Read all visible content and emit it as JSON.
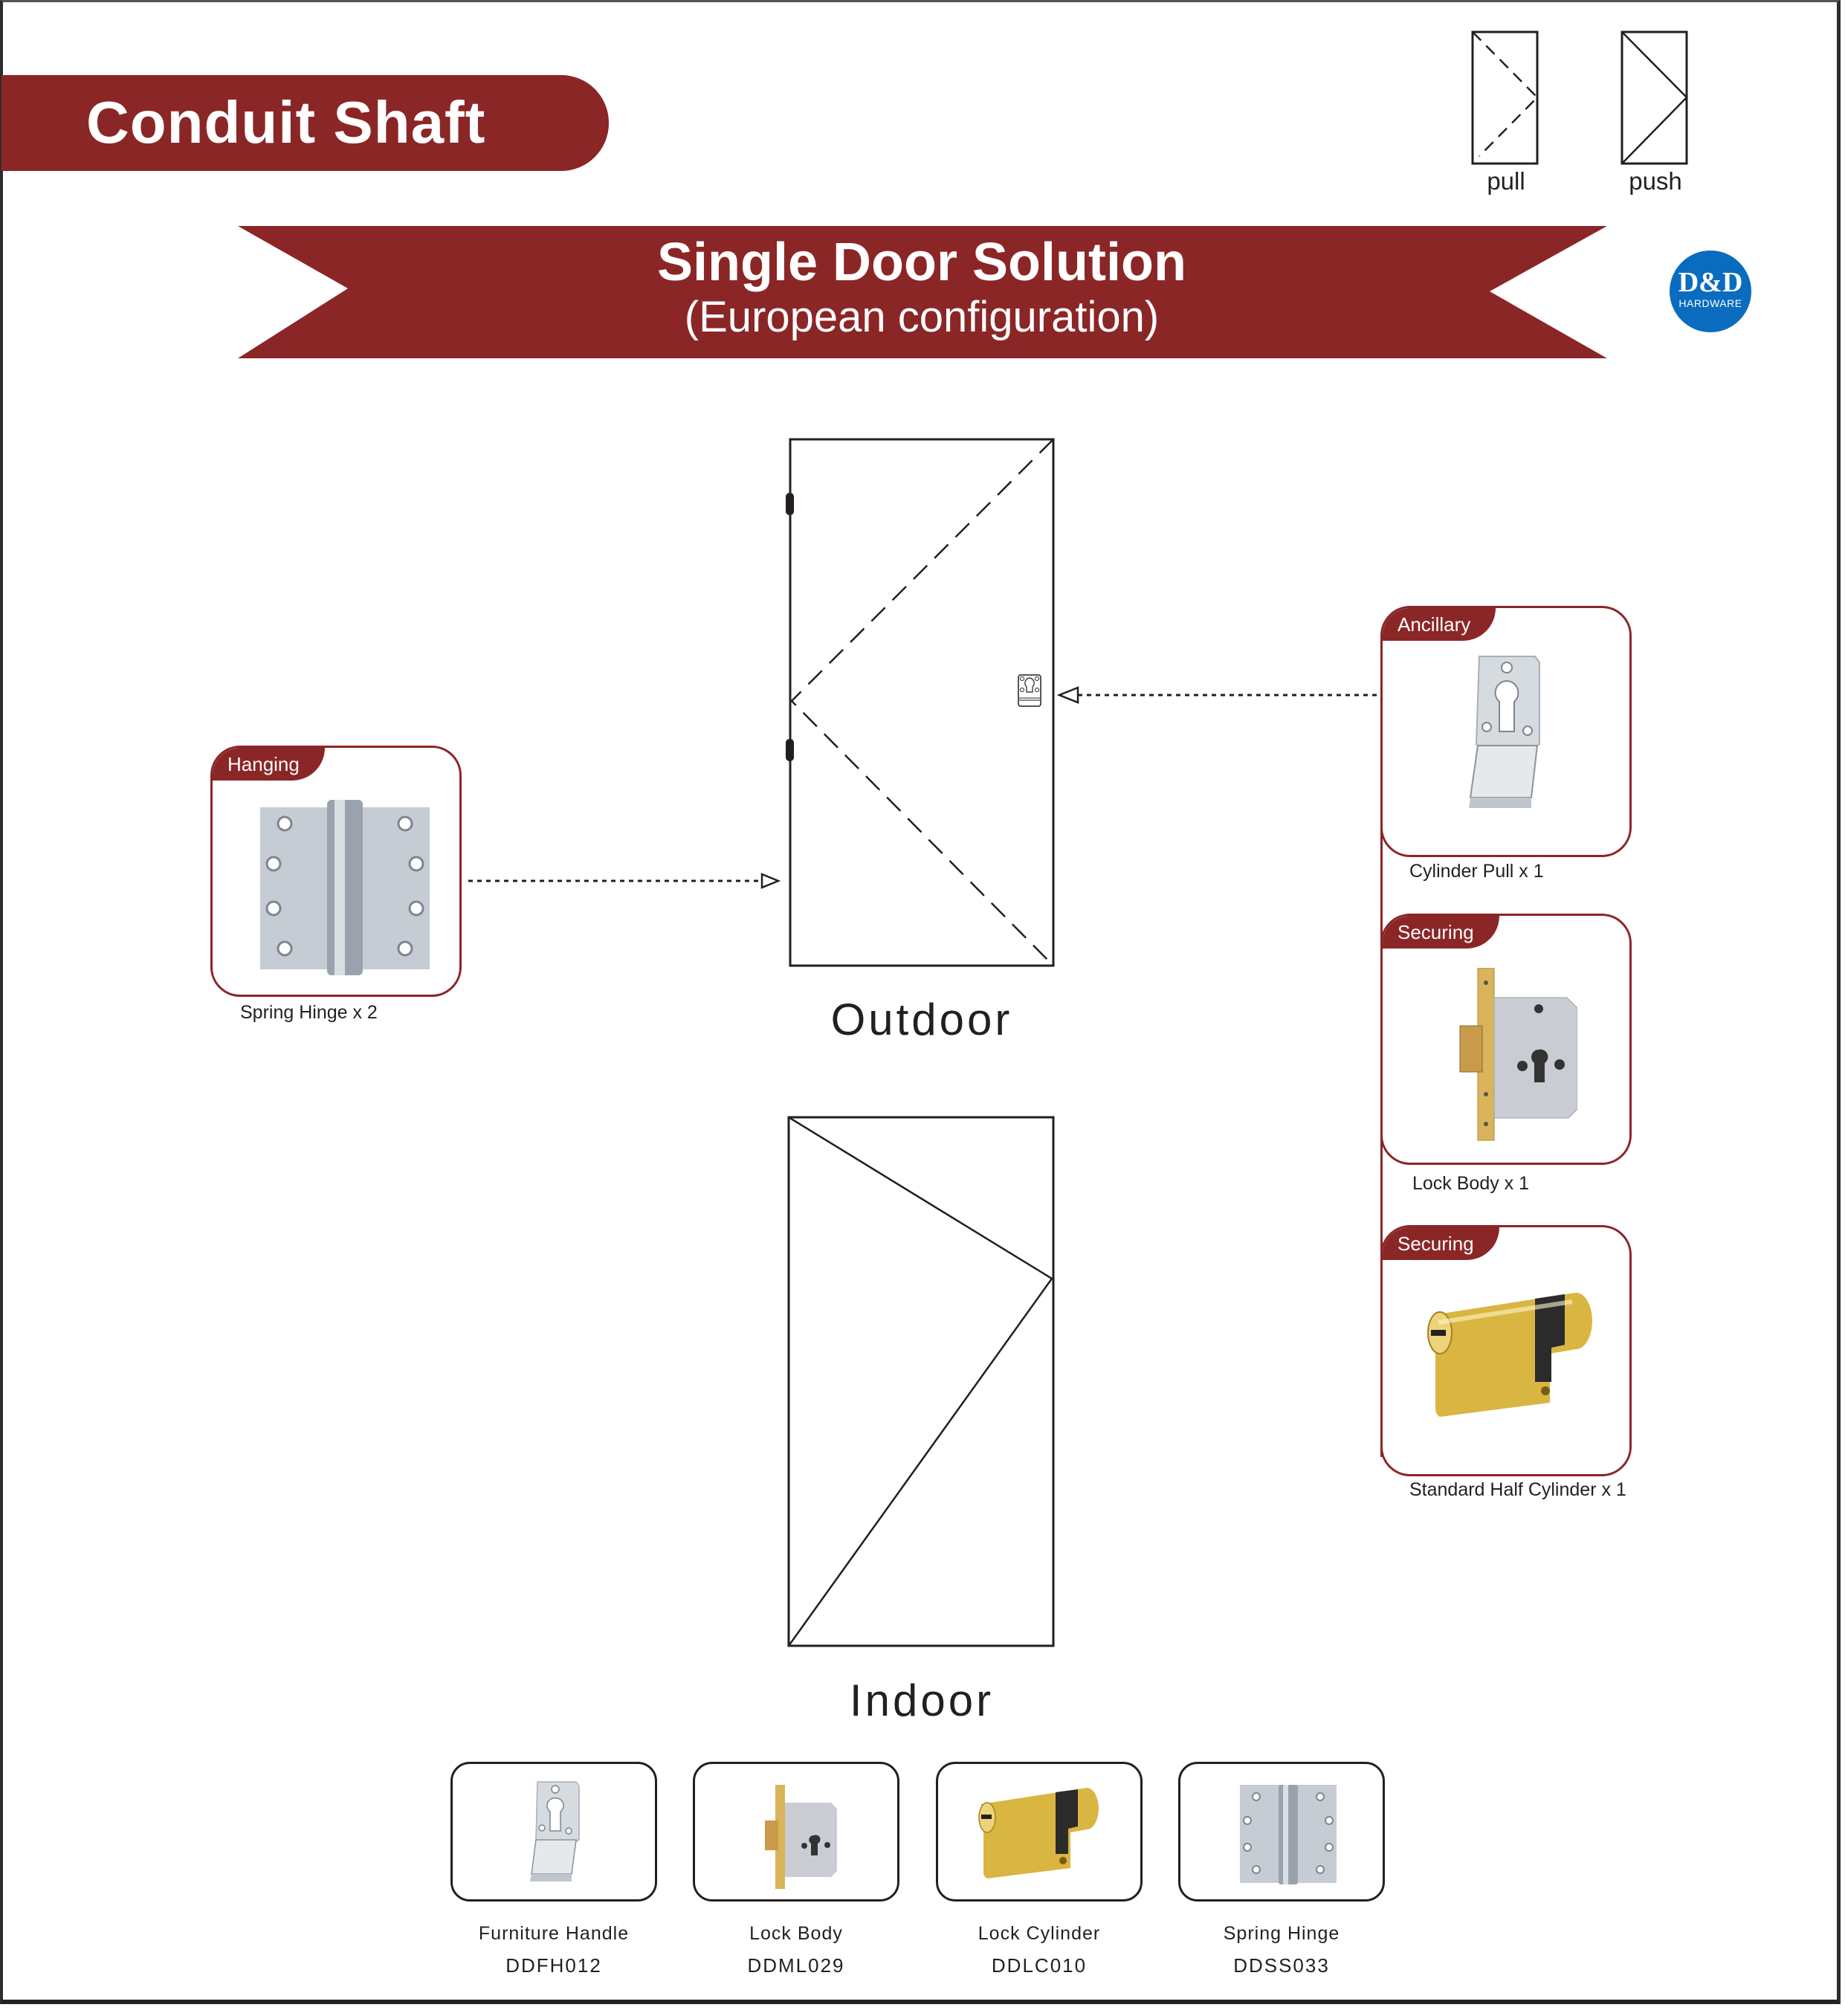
{
  "header": {
    "title": "Conduit Shaft"
  },
  "legend": {
    "items": [
      {
        "label": "pull",
        "style": "dashed"
      },
      {
        "label": "push",
        "style": "solid"
      }
    ]
  },
  "logo": {
    "mark": "D&D",
    "subtitle": "HARDWARE",
    "color": "#0a6cbf"
  },
  "banner": {
    "title": "Single Door Solution",
    "subtitle": "(European configuration)",
    "color": "#8b2627"
  },
  "doors": {
    "outdoor": {
      "label": "Outdoor",
      "opening": "pull"
    },
    "indoor": {
      "label": "Indoor",
      "opening": "push"
    }
  },
  "components": {
    "hanging": {
      "tag": "Hanging",
      "caption": "Spring Hinge x 2"
    },
    "ancillary": {
      "tag": "Ancillary",
      "caption": "Cylinder Pull  x 1"
    },
    "securing_lock": {
      "tag": "Securing",
      "caption": "Lock Body x 1"
    },
    "securing_cylinder": {
      "tag": "Securing",
      "caption": "Standard Half Cylinder x 1"
    }
  },
  "products": [
    {
      "name": "Furniture Handle",
      "code": "DDFH012"
    },
    {
      "name": "Lock Body",
      "code": "DDML029"
    },
    {
      "name": "Lock Cylinder",
      "code": "DDLC010"
    },
    {
      "name": "Spring Hinge",
      "code": "DDSS033"
    }
  ],
  "colors": {
    "accent": "#8b2627",
    "line": "#231f20"
  }
}
